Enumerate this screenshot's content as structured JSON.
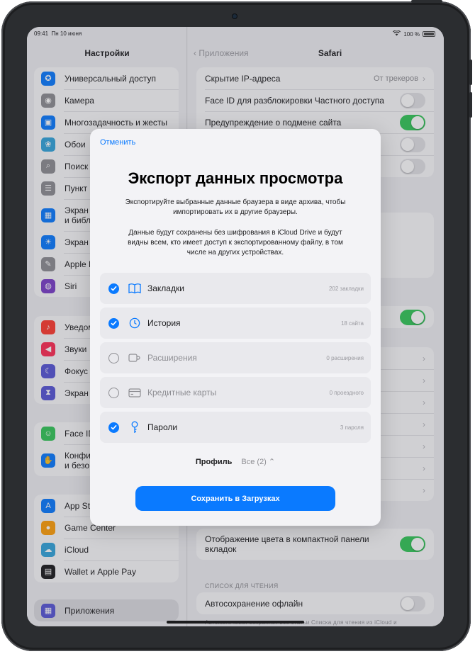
{
  "status": {
    "time": "09:41",
    "date": "Пн 10 июня",
    "battery": "100 %"
  },
  "sidebar": {
    "title": "Настройки",
    "group1": [
      {
        "label": "Универсальный доступ",
        "color": "#0a7aff",
        "icon": "accessibility-icon"
      },
      {
        "label": "Камера",
        "color": "#8e8e93",
        "icon": "camera-icon"
      },
      {
        "label": "Многозадачность и жесты",
        "color": "#0a7aff",
        "icon": "multitasking-icon"
      },
      {
        "label": "Обои",
        "color": "#32a5dc",
        "icon": "wallpaper-icon"
      },
      {
        "label": "Поиск",
        "color": "#8e8e93",
        "icon": "search-icon"
      },
      {
        "label": "Пункт",
        "color": "#8e8e93",
        "icon": "control-center-icon"
      },
      {
        "label": "Экран\nи библ",
        "color": "#0a7aff",
        "icon": "home-screen-icon"
      },
      {
        "label": "Экран",
        "color": "#0a7aff",
        "icon": "brightness-icon"
      },
      {
        "label": "Apple P",
        "color": "#8e8e93",
        "icon": "pencil-icon"
      },
      {
        "label": "Siri",
        "color": "#7a3ec8",
        "icon": "siri-icon"
      }
    ],
    "group2": [
      {
        "label": "Уведом",
        "color": "#ff3b30",
        "icon": "bell-icon"
      },
      {
        "label": "Звуки",
        "color": "#ff2d55",
        "icon": "speaker-icon"
      },
      {
        "label": "Фокус",
        "color": "#5856d6",
        "icon": "moon-icon"
      },
      {
        "label": "Экран",
        "color": "#5856d6",
        "icon": "hourglass-icon"
      }
    ],
    "group3": [
      {
        "label": "Face ID",
        "color": "#34c759",
        "icon": "face-id-icon"
      },
      {
        "label": "Конфи\nи безо",
        "color": "#0a7aff",
        "icon": "hand-icon"
      }
    ],
    "group4": [
      {
        "label": "App St",
        "color": "#0a7aff",
        "icon": "app-store-icon"
      },
      {
        "label": "Game Center",
        "color": "#ff9f0a",
        "icon": "game-center-icon"
      },
      {
        "label": "iCloud",
        "color": "#32a5dc",
        "icon": "cloud-icon"
      },
      {
        "label": "Wallet и Apple Pay",
        "color": "#1c1c1e",
        "icon": "wallet-icon"
      }
    ],
    "selected": {
      "label": "Приложения",
      "color": "#5856d6",
      "icon": "apps-icon"
    }
  },
  "detail": {
    "back": "Приложения",
    "title": "Safari",
    "rows_top": [
      {
        "label": "Скрытие IP-адреса",
        "value": "От трекеров"
      },
      {
        "label": "Face ID для разблокировки Частного доступа",
        "toggle": false
      },
      {
        "label": "Предупреждение о подмене сайта",
        "toggle": true
      }
    ],
    "compact_color_label": "Отображение цвета в компактной панели вкладок",
    "reading_list_section": "СПИСОК ДЛЯ ЧТЕНИЯ",
    "offline_label": "Автосохранение офлайн",
    "footer_note": "Автоматически сохраняет все статьи Списка для чтения из iCloud и"
  },
  "modal": {
    "cancel": "Отменить",
    "title": "Экспорт данных просмотра",
    "desc1": "Экспортируйте выбранные данные браузера в виде архива, чтобы импортировать их в другие браузеры.",
    "desc2": "Данные будут сохранены без шифрования в iCloud Drive и будут видны всем, кто имеет доступ к экспортированному файлу, в том числе на других устройствах.",
    "options": [
      {
        "label": "Закладки",
        "count": "202 закладки",
        "checked": true,
        "icon": "book-icon"
      },
      {
        "label": "История",
        "count": "18 сайта",
        "checked": true,
        "icon": "clock-icon"
      },
      {
        "label": "Расширения",
        "count": "0 расширения",
        "checked": false,
        "icon": "extension-icon"
      },
      {
        "label": "Кредитные карты",
        "count": "0 проездного",
        "checked": false,
        "icon": "credit-card-icon"
      },
      {
        "label": "Пароли",
        "count": "3 пароля",
        "checked": true,
        "icon": "key-icon"
      }
    ],
    "profile_label": "Профиль",
    "profile_value": "Все (2)",
    "save": "Сохранить в Загрузках"
  },
  "colors": {
    "accent": "#0a7aff",
    "toggle_on": "#34c759"
  }
}
